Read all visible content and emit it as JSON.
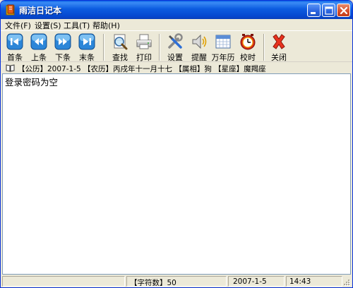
{
  "window": {
    "title": "雨洁日记本"
  },
  "menu": [
    {
      "label": "文件(F)"
    },
    {
      "label": "设置(S)"
    },
    {
      "label": "工具(T)"
    },
    {
      "label": "帮助(H)"
    }
  ],
  "toolbar": {
    "first": "首条",
    "prev": "上条",
    "next": "下条",
    "last": "末条",
    "find": "查找",
    "print": "打印",
    "settings": "设置",
    "remind": "提醒",
    "calendar": "万年历",
    "clock": "校时",
    "close": "关闭"
  },
  "info": {
    "text": "【公历】2007-1-5  【农历】丙戌年十一月十七  【属相】狗  【星座】魔羯座"
  },
  "editor": {
    "text": "登录密码为空"
  },
  "status": {
    "panel1": "",
    "char_count": "【字符数】50",
    "date": "2007-1-5",
    "time": "14:43"
  },
  "colors": {
    "titlebar": "#0a5fe6",
    "close_button": "#d8502e",
    "arrow_buttons": "#2c86d8"
  }
}
